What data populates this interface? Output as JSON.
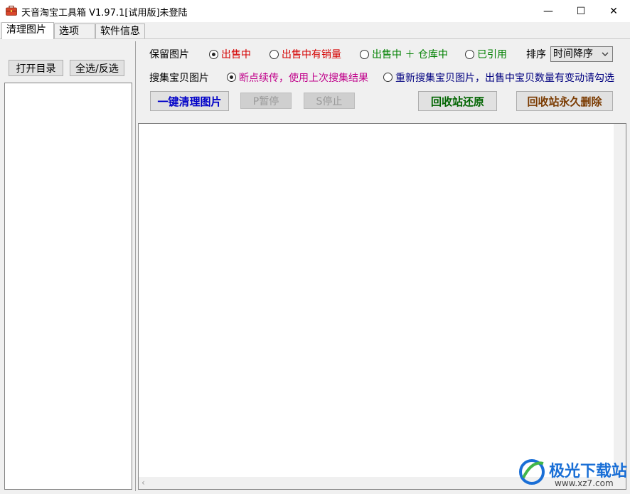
{
  "window": {
    "title": "天音淘宝工具箱 V1.97.1[试用版]未登陆",
    "minimize": "—",
    "maximize": "☐",
    "close": "✕",
    "icon": "toolbox-icon",
    "icon_color": "#d9462b"
  },
  "tabs": [
    {
      "label": "清理图片",
      "active": true
    },
    {
      "label": "选项",
      "active": false
    },
    {
      "label": "软件信息",
      "active": false
    }
  ],
  "left_panel": {
    "open_dir": "打开目录",
    "select_all": "全选/反选"
  },
  "keep_images": {
    "label": "保留图片",
    "options": [
      {
        "label": "出售中",
        "selected": true,
        "color": "#d40000"
      },
      {
        "label": "出售中有销量",
        "selected": false,
        "color": "#d40000"
      },
      {
        "label": "出售中 ＋ 仓库中",
        "selected": false,
        "color": "#008000"
      },
      {
        "label": "已引用",
        "selected": false,
        "color": "#008000"
      }
    ],
    "sort_label": "排序",
    "sort_value": "时间降序"
  },
  "collect": {
    "label": "搜集宝贝图片",
    "options": [
      {
        "label": "断点续传，使用上次搜集结果",
        "selected": true,
        "color": "#c0008a"
      },
      {
        "label": "重新搜集宝贝图片，出售中宝贝数量有变动请勾选",
        "selected": false,
        "color": "#000080"
      }
    ]
  },
  "actions": {
    "clean": "一键清理图片",
    "pause": "P暂停",
    "stop": "S停止",
    "restore": "回收站还原",
    "delete": "回收站永久删除",
    "clean_color": "#0000c8",
    "restore_color": "#006400",
    "delete_color": "#7a3a00"
  },
  "watermark": {
    "text": "极光下载站",
    "url": "www.xz7.com"
  }
}
